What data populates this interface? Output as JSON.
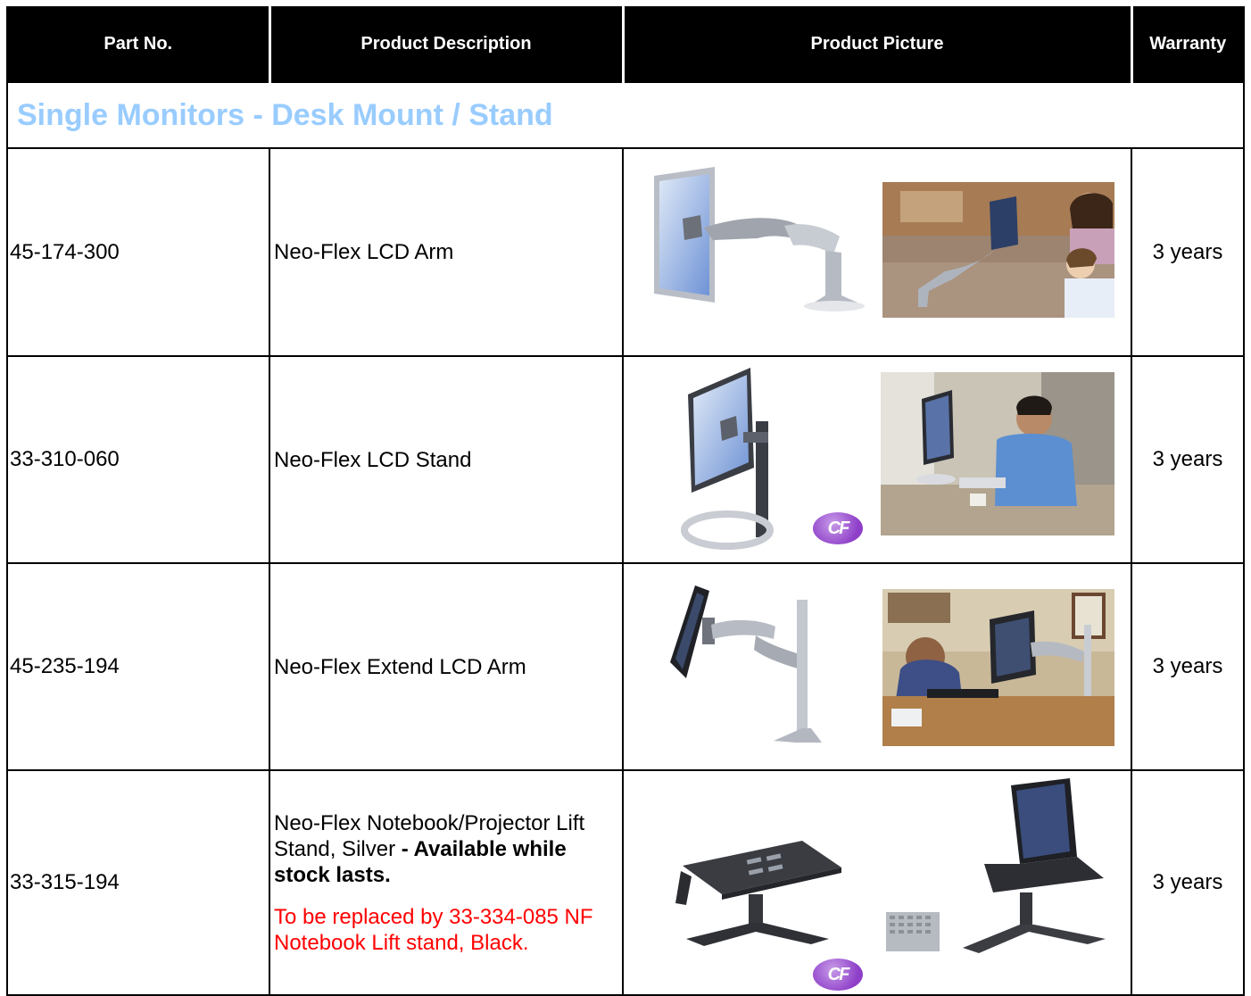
{
  "header": {
    "part_no": "Part No.",
    "description": "Product Description",
    "picture": "Product Picture",
    "warranty": "Warranty"
  },
  "section_title": "Single Monitors - Desk Mount / Stand",
  "products": [
    {
      "part_no": "45-174-300",
      "description": "Neo-Flex LCD Arm",
      "warranty": "3 years",
      "pictures": [
        "lcd-arm-product-icon",
        "lcd-arm-kitchen-photo"
      ]
    },
    {
      "part_no": "33-310-060",
      "description": "Neo-Flex LCD Stand",
      "warranty": "3 years",
      "cf_badge": "CF",
      "pictures": [
        "lcd-stand-product-icon",
        "lcd-stand-office-photo"
      ]
    },
    {
      "part_no": "45-235-194",
      "description": "Neo-Flex Extend LCD Arm",
      "warranty": "3 years",
      "pictures": [
        "extend-arm-product-icon",
        "extend-arm-office-photo"
      ]
    },
    {
      "part_no": "33-315-194",
      "description_line1": "Neo-Flex Notebook/Projector Lift Stand, Silver",
      "description_bold": " - Available while stock lasts.",
      "note": "To be replaced by 33-334-085 NF Notebook Lift stand, Black.",
      "warranty": "3 years",
      "cf_badge": "CF",
      "pictures": [
        "notebook-stand-product-icon",
        "notebook-stand-laptop-photo"
      ]
    }
  ],
  "colors": {
    "header_bg": "#000000",
    "header_text": "#ffffff",
    "section_text": "#99ccff",
    "note_text": "#ff0000",
    "cf_badge": "#8e3fc8"
  }
}
